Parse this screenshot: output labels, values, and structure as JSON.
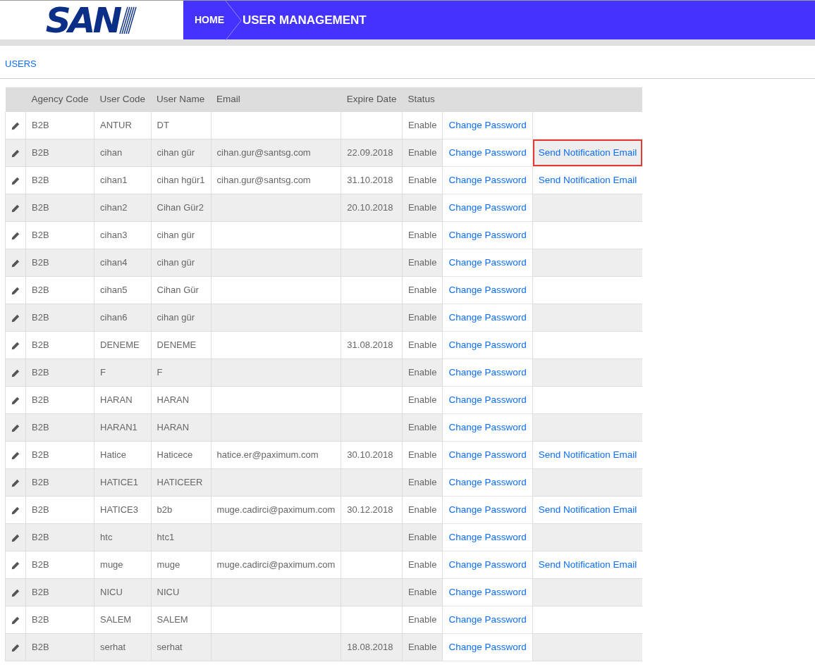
{
  "logo": {
    "text": "SAN"
  },
  "breadcrumb": [
    {
      "label": "HOME"
    },
    {
      "label": "USER MANAGEMENT"
    }
  ],
  "section_title": "USERS",
  "table": {
    "columns": [
      "",
      "Agency Code",
      "User Code",
      "User Name",
      "Email",
      "Expire Date",
      "Status",
      "",
      ""
    ],
    "rows": [
      {
        "agency_code": "B2B",
        "user_code": "ANTUR",
        "user_name": "DT",
        "status": "Enable",
        "change_password": "Change Password",
        "highlighted": false
      },
      {
        "agency_code": "B2B",
        "user_code": "cihan",
        "user_name": "cihan gür",
        "email": "cihan.gur@santsg.com",
        "expire_date": "22.09.2018",
        "status": "Enable",
        "change_password": "Change Password",
        "send_notification": "Send Notification Email",
        "highlighted": true
      },
      {
        "agency_code": "B2B",
        "user_code": "cihan1",
        "user_name": "cihan hgür1",
        "email": "cihan.gur@santsg.com",
        "expire_date": "31.10.2018",
        "status": "Enable",
        "change_password": "Change Password",
        "send_notification": "Send Notification Email",
        "highlighted": false
      },
      {
        "agency_code": "B2B",
        "user_code": "cihan2",
        "user_name": "Cihan Gür2",
        "expire_date": "20.10.2018",
        "status": "Enable",
        "change_password": "Change Password",
        "highlighted": false
      },
      {
        "agency_code": "B2B",
        "user_code": "cihan3",
        "user_name": "cihan gür",
        "status": "Enable",
        "change_password": "Change Password",
        "highlighted": false
      },
      {
        "agency_code": "B2B",
        "user_code": "cihan4",
        "user_name": "cihan gür",
        "status": "Enable",
        "change_password": "Change Password",
        "highlighted": false
      },
      {
        "agency_code": "B2B",
        "user_code": "cihan5",
        "user_name": "Cihan Gür",
        "status": "Enable",
        "change_password": "Change Password",
        "highlighted": false
      },
      {
        "agency_code": "B2B",
        "user_code": "cihan6",
        "user_name": "cihan gür",
        "status": "Enable",
        "change_password": "Change Password",
        "highlighted": false
      },
      {
        "agency_code": "B2B",
        "user_code": "DENEME",
        "user_name": "DENEME",
        "expire_date": "31.08.2018",
        "status": "Enable",
        "change_password": "Change Password",
        "highlighted": false
      },
      {
        "agency_code": "B2B",
        "user_code": "F",
        "user_name": "F",
        "status": "Enable",
        "change_password": "Change Password",
        "highlighted": false
      },
      {
        "agency_code": "B2B",
        "user_code": "HARAN",
        "user_name": "HARAN",
        "status": "Enable",
        "change_password": "Change Password",
        "highlighted": false
      },
      {
        "agency_code": "B2B",
        "user_code": "HARAN1",
        "user_name": "HARAN",
        "status": "Enable",
        "change_password": "Change Password",
        "highlighted": false
      },
      {
        "agency_code": "B2B",
        "user_code": "Hatice",
        "user_name": "Haticece",
        "email": "hatice.er@paximum.com",
        "expire_date": "30.10.2018",
        "status": "Enable",
        "change_password": "Change Password",
        "send_notification": "Send Notification Email",
        "highlighted": false
      },
      {
        "agency_code": "B2B",
        "user_code": "HATICE1",
        "user_name": "HATICEER",
        "status": "Enable",
        "change_password": "Change Password",
        "highlighted": false
      },
      {
        "agency_code": "B2B",
        "user_code": "HATICE3",
        "user_name": "b2b",
        "email": "muge.cadirci@paximum.com",
        "expire_date": "30.12.2018",
        "status": "Enable",
        "change_password": "Change Password",
        "send_notification": "Send Notification Email",
        "highlighted": false
      },
      {
        "agency_code": "B2B",
        "user_code": "htc",
        "user_name": "htc1",
        "status": "Enable",
        "change_password": "Change Password",
        "highlighted": false
      },
      {
        "agency_code": "B2B",
        "user_code": "muge",
        "user_name": "muge",
        "email": "muge.cadirci@paximum.com",
        "status": "Enable",
        "change_password": "Change Password",
        "send_notification": "Send Notification Email",
        "highlighted": false
      },
      {
        "agency_code": "B2B",
        "user_code": "NICU",
        "user_name": "NICU",
        "status": "Enable",
        "change_password": "Change Password",
        "highlighted": false
      },
      {
        "agency_code": "B2B",
        "user_code": "SALEM",
        "user_name": "SALEM",
        "status": "Enable",
        "change_password": "Change Password",
        "highlighted": false
      },
      {
        "agency_code": "B2B",
        "user_code": "serhat",
        "user_name": "serhat",
        "expire_date": "18.08.2018",
        "status": "Enable",
        "change_password": "Change Password",
        "highlighted": false
      }
    ]
  }
}
